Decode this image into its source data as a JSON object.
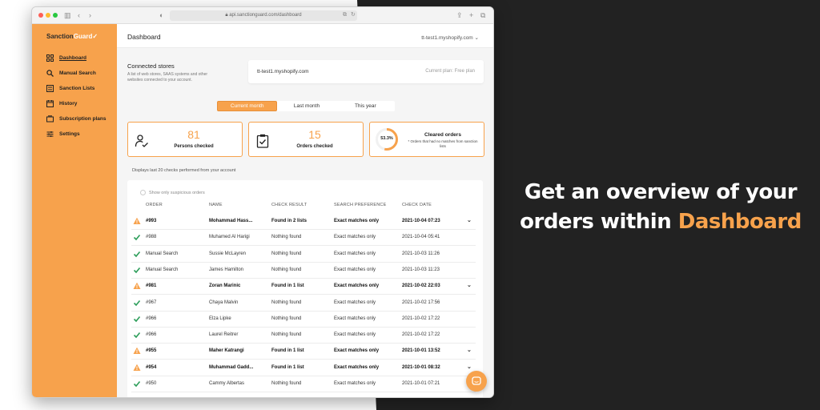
{
  "headline": {
    "line1": "Get an overview of your",
    "line2_prefix": "orders within ",
    "line2_accent": "Dashboard"
  },
  "browser": {
    "url": "api.sanctionguard.com/dashboard"
  },
  "sidebar": {
    "logo_part1": "Sanction",
    "logo_part2": "Guard",
    "items": [
      {
        "label": "Dashboard",
        "icon": "dashboard-icon",
        "active": true
      },
      {
        "label": "Manual Search",
        "icon": "search-icon",
        "active": false
      },
      {
        "label": "Sanction Lists",
        "icon": "list-icon",
        "active": false
      },
      {
        "label": "History",
        "icon": "history-icon",
        "active": false
      },
      {
        "label": "Subscription plans",
        "icon": "subscription-icon",
        "active": false
      },
      {
        "label": "Settings",
        "icon": "settings-icon",
        "active": false
      }
    ]
  },
  "topbar": {
    "title": "Dashboard",
    "store_selector": "tt-test1.myshopify.com"
  },
  "connected_stores": {
    "title": "Connected stores",
    "description": "A list of web stores, SAAS systems and other websites connected to your account.",
    "store": "tt-test1.myshopify.com",
    "plan": "Current plan: Free plan"
  },
  "period_tabs": [
    "Current month",
    "Last month",
    "This year"
  ],
  "stats": {
    "persons": {
      "value": "81",
      "label": "Persons checked"
    },
    "orders": {
      "value": "15",
      "label": "Orders checked"
    },
    "cleared": {
      "percent": "53.3%",
      "fraction": 0.533,
      "title": "Cleared orders",
      "desc": "* Orders that had no matches from sanction lists"
    }
  },
  "table": {
    "note": "Displays last 20 checks performed from your account",
    "filter_label": "Show only suspicious orders",
    "headers": [
      "ORDER",
      "NAME",
      "CHECK RESULT",
      "SEARCH PREFERENCE",
      "CHECK DATE"
    ],
    "rows": [
      {
        "status": "warning",
        "order": "#993",
        "name": "Mohammad Hass...",
        "result": "Found in 2 lists",
        "pref": "Exact matches only",
        "date": "2021-10-04 07:23"
      },
      {
        "status": "ok",
        "order": "#988",
        "name": "Muhamed Al Harigi",
        "result": "Nothing found",
        "pref": "Exact matches only",
        "date": "2021-10-04 05:41"
      },
      {
        "status": "ok",
        "order": "Manual Search",
        "name": "Sussie McLayren",
        "result": "Nothing found",
        "pref": "Exact matches only",
        "date": "2021-10-03 11:26"
      },
      {
        "status": "ok",
        "order": "Manual Search",
        "name": "James Hamilton",
        "result": "Nothing found",
        "pref": "Exact matches only",
        "date": "2021-10-03 11:23"
      },
      {
        "status": "warning",
        "order": "#981",
        "name": "Zoran Marinic",
        "result": "Found in 1 list",
        "pref": "Exact matches only",
        "date": "2021-10-02 22:03"
      },
      {
        "status": "ok",
        "order": "#967",
        "name": "Chaya Malvin",
        "result": "Nothing found",
        "pref": "Exact matches only",
        "date": "2021-10-02 17:56"
      },
      {
        "status": "ok",
        "order": "#966",
        "name": "Elza Lipke",
        "result": "Nothing found",
        "pref": "Exact matches only",
        "date": "2021-10-02 17:22"
      },
      {
        "status": "ok",
        "order": "#966",
        "name": "Laurel Reitrer",
        "result": "Nothing found",
        "pref": "Exact matches only",
        "date": "2021-10-02 17:22"
      },
      {
        "status": "warning",
        "order": "#955",
        "name": "Maher Katrangi",
        "result": "Found in 1 list",
        "pref": "Exact matches only",
        "date": "2021-10-01 13:52"
      },
      {
        "status": "warning",
        "order": "#954",
        "name": "Muhammad Gadd...",
        "result": "Found in 1 list",
        "pref": "Exact matches only",
        "date": "2021-10-01 08:32"
      },
      {
        "status": "ok",
        "order": "#950",
        "name": "Cammy Albertas",
        "result": "Nothing found",
        "pref": "Exact matches only",
        "date": "2021-10-01 07:21"
      }
    ]
  },
  "colors": {
    "accent": "#f7a24c",
    "dark_bg": "#222222",
    "ok": "#2e9e5b",
    "warning": "#f7a24c"
  }
}
